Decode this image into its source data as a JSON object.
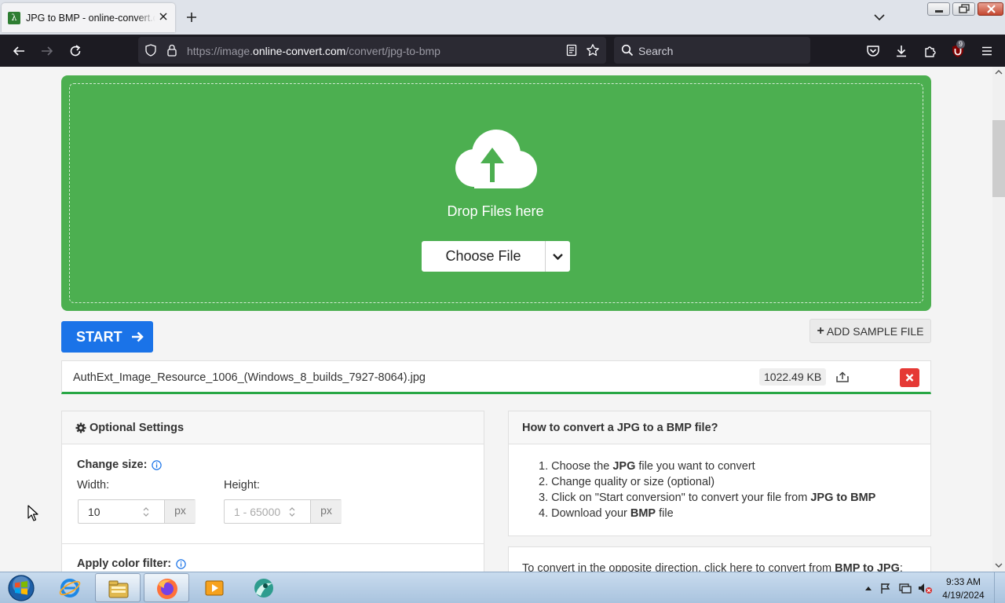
{
  "browser": {
    "tab_title": "JPG to BMP - online-convert.com",
    "url_prefix": "https://image.",
    "url_host": "online-convert.com",
    "url_path": "/convert/jpg-to-bmp",
    "search_placeholder": "Search",
    "extension_badge": "9"
  },
  "dropzone": {
    "drop_text": "Drop Files here",
    "choose_file_label": "Choose File"
  },
  "actions": {
    "start_label": "START",
    "add_sample_label": "ADD SAMPLE FILE"
  },
  "file": {
    "name": "AuthExt_Image_Resource_1006_(Windows_8_builds_7927-8064).jpg",
    "size": "1022.49 KB",
    "upload_progress": 1.0
  },
  "settings": {
    "title": "Optional Settings",
    "change_size_label": "Change size:",
    "width_label": "Width:",
    "width_value": "10",
    "height_label": "Height:",
    "height_placeholder": "1 - 65000",
    "unit": "px",
    "color_filter_label": "Apply color filter:"
  },
  "howto": {
    "title": "How to convert a JPG to a BMP file?",
    "steps": [
      {
        "num": "1.",
        "pre": "Choose the ",
        "bold": "JPG",
        "post": " file you want to convert"
      },
      {
        "num": "2.",
        "pre": "Change quality or size (optional)",
        "bold": "",
        "post": ""
      },
      {
        "num": "3.",
        "pre": "Click on \"Start conversion\" to convert your file from ",
        "bold": "JPG to BMP",
        "post": ""
      },
      {
        "num": "4.",
        "pre": "Download your ",
        "bold": "BMP",
        "post": " file"
      }
    ],
    "opposite_pre": "To convert in the opposite direction, click here to convert from ",
    "opposite_bold": "BMP to JPG",
    "opposite_post": ":"
  },
  "taskbar": {
    "time": "9:33 AM",
    "date": "4/19/2024"
  },
  "colors": {
    "dropzone_green": "#4caf50",
    "start_blue": "#1a73e8",
    "remove_red": "#e53935",
    "progress_green": "#28a745"
  },
  "icons": [
    "favicon-icon",
    "close-tab-icon",
    "new-tab-icon",
    "tab-list-icon",
    "back-icon",
    "forward-icon",
    "reload-icon",
    "shield-icon",
    "lock-icon",
    "reader-view-icon",
    "bookmark-star-icon",
    "search-icon",
    "pocket-icon",
    "download-icon",
    "extensions-icon",
    "ublock-icon",
    "menu-icon",
    "cloud-upload-icon",
    "chevron-down-icon",
    "arrow-right-icon",
    "plus-icon",
    "upload-icon",
    "close-icon",
    "gear-icon",
    "info-icon",
    "windows-start-icon",
    "ie-icon",
    "explorer-icon",
    "firefox-icon",
    "media-player-icon",
    "app-icon"
  ]
}
